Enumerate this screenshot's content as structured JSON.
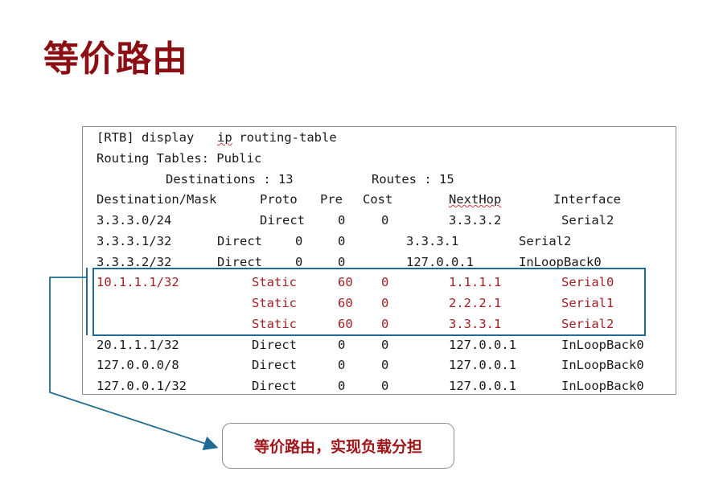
{
  "title": "等价路由",
  "terminal": {
    "command_prompt": "[RTB] display ",
    "command_ip": "ip",
    "command_rest": " routing-table",
    "tables_line": "Routing Tables: Public",
    "dest_label": "Destinations : 13",
    "routes_label": "Routes : 15",
    "headers": [
      "Destination/Mask",
      "Proto",
      "Pre",
      "Cost",
      "NextHop",
      "Interface"
    ],
    "rows": [
      [
        "3.3.3.0/24",
        "Direct",
        "0",
        "0",
        "3.3.3.2",
        "Serial2"
      ],
      [
        "3.3.3.1/32",
        "Direct",
        "0",
        "0",
        "3.3.3.1",
        "Serial2"
      ],
      [
        "3.3.3.2/32",
        "Direct",
        "0",
        "0",
        "127.0.0.1",
        "InLoopBack0"
      ],
      [
        "10.1.1.1/32",
        "Static",
        "60",
        "0",
        "1.1.1.1",
        "Serial0"
      ],
      [
        "",
        "Static",
        "60",
        "0",
        "2.2.2.1",
        "Serial1"
      ],
      [
        "",
        "Static",
        "60",
        "0",
        "3.3.3.1",
        "Serial2"
      ],
      [
        "20.1.1.1/32",
        "Direct",
        "0",
        "0",
        "127.0.0.1",
        "InLoopBack0"
      ],
      [
        "127.0.0.0/8",
        "Direct",
        "0",
        "0",
        "127.0.0.1",
        "InLoopBack0"
      ],
      [
        "127.0.0.1/32",
        "Direct",
        "0",
        "0",
        "127.0.0.1",
        "InLoopBack0"
      ]
    ]
  },
  "callout": {
    "text": "等价路由，实现负载分担"
  },
  "colors": {
    "title": "#8b0f12",
    "highlight_text": "#a32125",
    "frame": "#1f6b92",
    "callout_text": "#a01519"
  }
}
